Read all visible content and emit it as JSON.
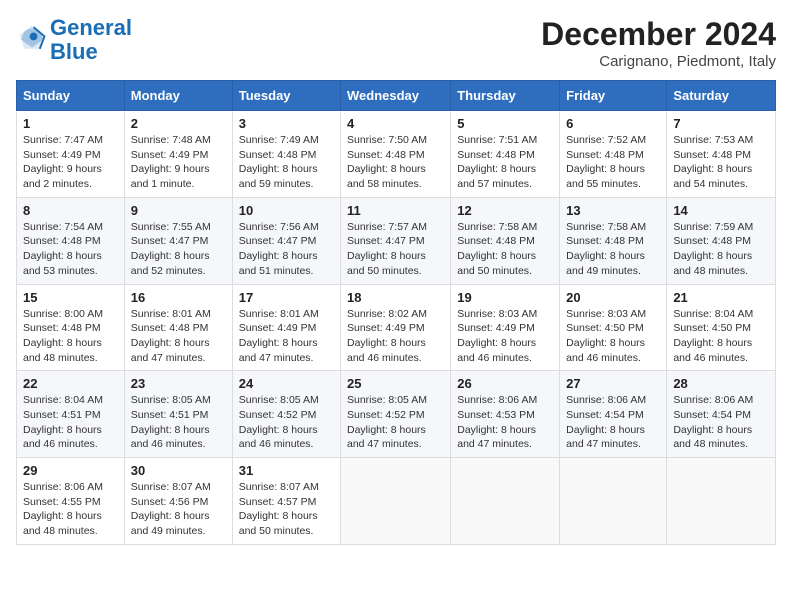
{
  "logo": {
    "line1": "General",
    "line2": "Blue"
  },
  "title": "December 2024",
  "location": "Carignano, Piedmont, Italy",
  "days_of_week": [
    "Sunday",
    "Monday",
    "Tuesday",
    "Wednesday",
    "Thursday",
    "Friday",
    "Saturday"
  ],
  "weeks": [
    [
      {
        "day": "1",
        "sunrise": "Sunrise: 7:47 AM",
        "sunset": "Sunset: 4:49 PM",
        "daylight": "Daylight: 9 hours and 2 minutes."
      },
      {
        "day": "2",
        "sunrise": "Sunrise: 7:48 AM",
        "sunset": "Sunset: 4:49 PM",
        "daylight": "Daylight: 9 hours and 1 minute."
      },
      {
        "day": "3",
        "sunrise": "Sunrise: 7:49 AM",
        "sunset": "Sunset: 4:48 PM",
        "daylight": "Daylight: 8 hours and 59 minutes."
      },
      {
        "day": "4",
        "sunrise": "Sunrise: 7:50 AM",
        "sunset": "Sunset: 4:48 PM",
        "daylight": "Daylight: 8 hours and 58 minutes."
      },
      {
        "day": "5",
        "sunrise": "Sunrise: 7:51 AM",
        "sunset": "Sunset: 4:48 PM",
        "daylight": "Daylight: 8 hours and 57 minutes."
      },
      {
        "day": "6",
        "sunrise": "Sunrise: 7:52 AM",
        "sunset": "Sunset: 4:48 PM",
        "daylight": "Daylight: 8 hours and 55 minutes."
      },
      {
        "day": "7",
        "sunrise": "Sunrise: 7:53 AM",
        "sunset": "Sunset: 4:48 PM",
        "daylight": "Daylight: 8 hours and 54 minutes."
      }
    ],
    [
      {
        "day": "8",
        "sunrise": "Sunrise: 7:54 AM",
        "sunset": "Sunset: 4:48 PM",
        "daylight": "Daylight: 8 hours and 53 minutes."
      },
      {
        "day": "9",
        "sunrise": "Sunrise: 7:55 AM",
        "sunset": "Sunset: 4:47 PM",
        "daylight": "Daylight: 8 hours and 52 minutes."
      },
      {
        "day": "10",
        "sunrise": "Sunrise: 7:56 AM",
        "sunset": "Sunset: 4:47 PM",
        "daylight": "Daylight: 8 hours and 51 minutes."
      },
      {
        "day": "11",
        "sunrise": "Sunrise: 7:57 AM",
        "sunset": "Sunset: 4:47 PM",
        "daylight": "Daylight: 8 hours and 50 minutes."
      },
      {
        "day": "12",
        "sunrise": "Sunrise: 7:58 AM",
        "sunset": "Sunset: 4:48 PM",
        "daylight": "Daylight: 8 hours and 50 minutes."
      },
      {
        "day": "13",
        "sunrise": "Sunrise: 7:58 AM",
        "sunset": "Sunset: 4:48 PM",
        "daylight": "Daylight: 8 hours and 49 minutes."
      },
      {
        "day": "14",
        "sunrise": "Sunrise: 7:59 AM",
        "sunset": "Sunset: 4:48 PM",
        "daylight": "Daylight: 8 hours and 48 minutes."
      }
    ],
    [
      {
        "day": "15",
        "sunrise": "Sunrise: 8:00 AM",
        "sunset": "Sunset: 4:48 PM",
        "daylight": "Daylight: 8 hours and 48 minutes."
      },
      {
        "day": "16",
        "sunrise": "Sunrise: 8:01 AM",
        "sunset": "Sunset: 4:48 PM",
        "daylight": "Daylight: 8 hours and 47 minutes."
      },
      {
        "day": "17",
        "sunrise": "Sunrise: 8:01 AM",
        "sunset": "Sunset: 4:49 PM",
        "daylight": "Daylight: 8 hours and 47 minutes."
      },
      {
        "day": "18",
        "sunrise": "Sunrise: 8:02 AM",
        "sunset": "Sunset: 4:49 PM",
        "daylight": "Daylight: 8 hours and 46 minutes."
      },
      {
        "day": "19",
        "sunrise": "Sunrise: 8:03 AM",
        "sunset": "Sunset: 4:49 PM",
        "daylight": "Daylight: 8 hours and 46 minutes."
      },
      {
        "day": "20",
        "sunrise": "Sunrise: 8:03 AM",
        "sunset": "Sunset: 4:50 PM",
        "daylight": "Daylight: 8 hours and 46 minutes."
      },
      {
        "day": "21",
        "sunrise": "Sunrise: 8:04 AM",
        "sunset": "Sunset: 4:50 PM",
        "daylight": "Daylight: 8 hours and 46 minutes."
      }
    ],
    [
      {
        "day": "22",
        "sunrise": "Sunrise: 8:04 AM",
        "sunset": "Sunset: 4:51 PM",
        "daylight": "Daylight: 8 hours and 46 minutes."
      },
      {
        "day": "23",
        "sunrise": "Sunrise: 8:05 AM",
        "sunset": "Sunset: 4:51 PM",
        "daylight": "Daylight: 8 hours and 46 minutes."
      },
      {
        "day": "24",
        "sunrise": "Sunrise: 8:05 AM",
        "sunset": "Sunset: 4:52 PM",
        "daylight": "Daylight: 8 hours and 46 minutes."
      },
      {
        "day": "25",
        "sunrise": "Sunrise: 8:05 AM",
        "sunset": "Sunset: 4:52 PM",
        "daylight": "Daylight: 8 hours and 47 minutes."
      },
      {
        "day": "26",
        "sunrise": "Sunrise: 8:06 AM",
        "sunset": "Sunset: 4:53 PM",
        "daylight": "Daylight: 8 hours and 47 minutes."
      },
      {
        "day": "27",
        "sunrise": "Sunrise: 8:06 AM",
        "sunset": "Sunset: 4:54 PM",
        "daylight": "Daylight: 8 hours and 47 minutes."
      },
      {
        "day": "28",
        "sunrise": "Sunrise: 8:06 AM",
        "sunset": "Sunset: 4:54 PM",
        "daylight": "Daylight: 8 hours and 48 minutes."
      }
    ],
    [
      {
        "day": "29",
        "sunrise": "Sunrise: 8:06 AM",
        "sunset": "Sunset: 4:55 PM",
        "daylight": "Daylight: 8 hours and 48 minutes."
      },
      {
        "day": "30",
        "sunrise": "Sunrise: 8:07 AM",
        "sunset": "Sunset: 4:56 PM",
        "daylight": "Daylight: 8 hours and 49 minutes."
      },
      {
        "day": "31",
        "sunrise": "Sunrise: 8:07 AM",
        "sunset": "Sunset: 4:57 PM",
        "daylight": "Daylight: 8 hours and 50 minutes."
      },
      null,
      null,
      null,
      null
    ]
  ]
}
